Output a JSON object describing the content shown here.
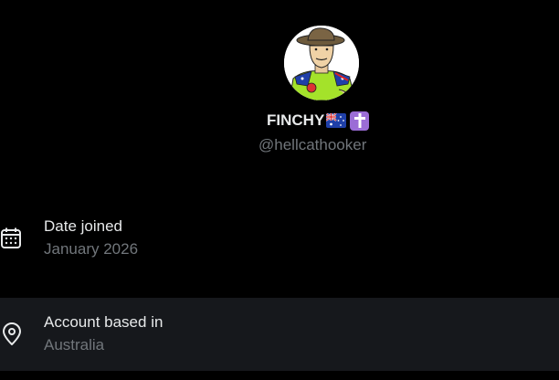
{
  "profile": {
    "display_name": "FINCHY",
    "handle": "@hellcathooker",
    "name_emojis": [
      "australia-flag-icon",
      "latin-cross-icon"
    ]
  },
  "details": {
    "date_joined": {
      "label": "Date joined",
      "value": "January 2026",
      "icon": "calendar-icon"
    },
    "account_based_in": {
      "label": "Account based in",
      "value": "Australia",
      "icon": "location-pin-icon"
    }
  },
  "colors": {
    "background": "#000000",
    "highlight_row": "#16181c",
    "primary_text": "#e7e9ea",
    "secondary_text": "#71767b",
    "cross_emoji_bg": "#9b6dd6"
  }
}
